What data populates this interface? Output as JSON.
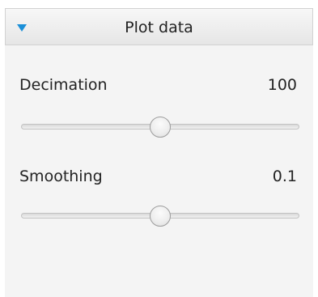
{
  "panel": {
    "title": "Plot data",
    "collapse_icon": "triangle-down-icon",
    "accent_color": "#1a8fd8"
  },
  "decimation": {
    "label": "Decimation",
    "value": "100",
    "slider_position": 0.5
  },
  "smoothing": {
    "label": "Smoothing",
    "value": "0.1",
    "slider_position": 0.5
  }
}
